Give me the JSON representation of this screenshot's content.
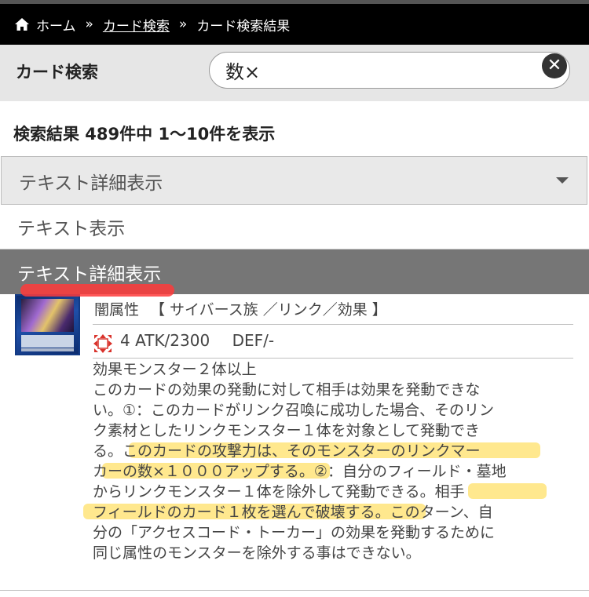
{
  "breadcrumb": {
    "items": [
      "ホーム",
      "カード検索",
      "カード検索結果"
    ],
    "separator": "»"
  },
  "search": {
    "label": "カード検索",
    "value": "数×",
    "clear_icon": "close-circle-icon"
  },
  "results": {
    "count_text": "検索結果 489件中 1〜10件を表示"
  },
  "display_select": {
    "selected": "テキスト詳細表示",
    "options": [
      "テキスト表示",
      "テキスト詳細表示"
    ]
  },
  "card": {
    "attribute": "闇属性",
    "type_text": "【 サイバース族 ／リンク／効果 】",
    "link_rating": "4",
    "atk": "ATK/2300",
    "def": "DEF/-",
    "effect_lines": [
      "効果モンスター２体以上",
      "このカードの効果の発動に対して相手は効果を発動できな",
      "い。①：このカードがリンク召喚に成功した場合、そのリン",
      "ク素材としたリンクモンスター１体を対象として発動でき",
      "る。このカードの攻撃力は、そのモンスターのリンクマー",
      "カーの数×１０００アップする。②：自分のフィールド・墓地",
      "からリンクモンスター１体を除外して発動できる。相手",
      "フィールドのカード１枚を選んで破壊する。このターン、自",
      "分の「アクセスコード・トーカー」の効果を発動するために",
      "同じ属性のモンスターを除外する事はできない。"
    ]
  },
  "colors": {
    "breadcrumb_bg": "#000000",
    "search_panel_bg": "#e6e6e6",
    "selected_option_bg": "#767676",
    "highlight": "#ffd632",
    "red_mark": "#ff3b3b"
  }
}
